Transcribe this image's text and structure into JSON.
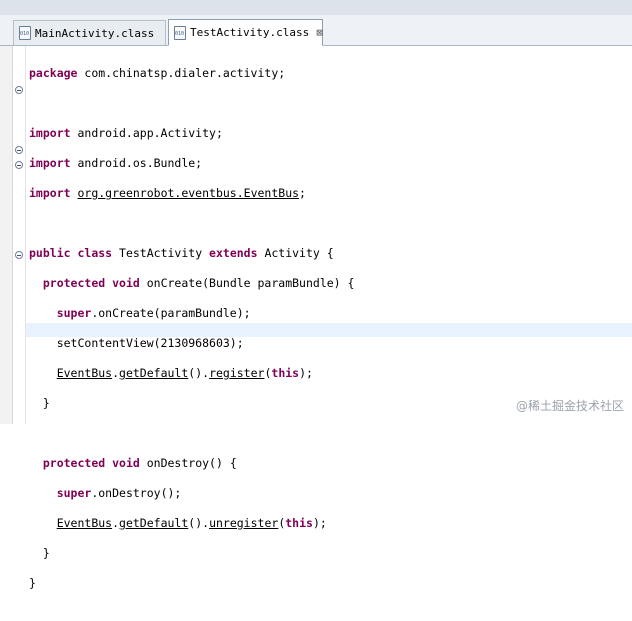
{
  "tabs": [
    {
      "label": "MainActivity.class",
      "active": false
    },
    {
      "label": "TestActivity.class",
      "active": true
    }
  ],
  "code": {
    "line1_kw": "package",
    "line1_rest": " com.chinatsp.dialer.activity;",
    "imp_kw": "import",
    "imp1": " android.app.Activity;",
    "imp2": " android.os.Bundle;",
    "imp3": "org.greenrobot.eventbus.EventBus",
    "semi": ";",
    "cls_kw1": "public",
    "cls_kw2": "class",
    "cls_name": " TestActivity ",
    "cls_kw3": "extends",
    "cls_rest": " Activity {",
    "m_kw1": "protected",
    "m_kw2": "void",
    "oncreate_sig": " onCreate(Bundle paramBundle) {",
    "super_kw": "super",
    "oncreate_call": ".onCreate(paramBundle);",
    "setcontent": "setContentView(2130968603);",
    "eventbus": "EventBus",
    "dot": ".",
    "getdefault": "getDefault",
    "paren_dot": "().",
    "register": "register",
    "open_paren": "(",
    "this_kw": "this",
    "close_semi": ");",
    "close_brace": "}",
    "ondestroy_sig": " onDestroy() {",
    "ondestroy_call": ".onDestroy();",
    "unregister": "unregister"
  },
  "watermark": "@稀土掘金技术社区"
}
